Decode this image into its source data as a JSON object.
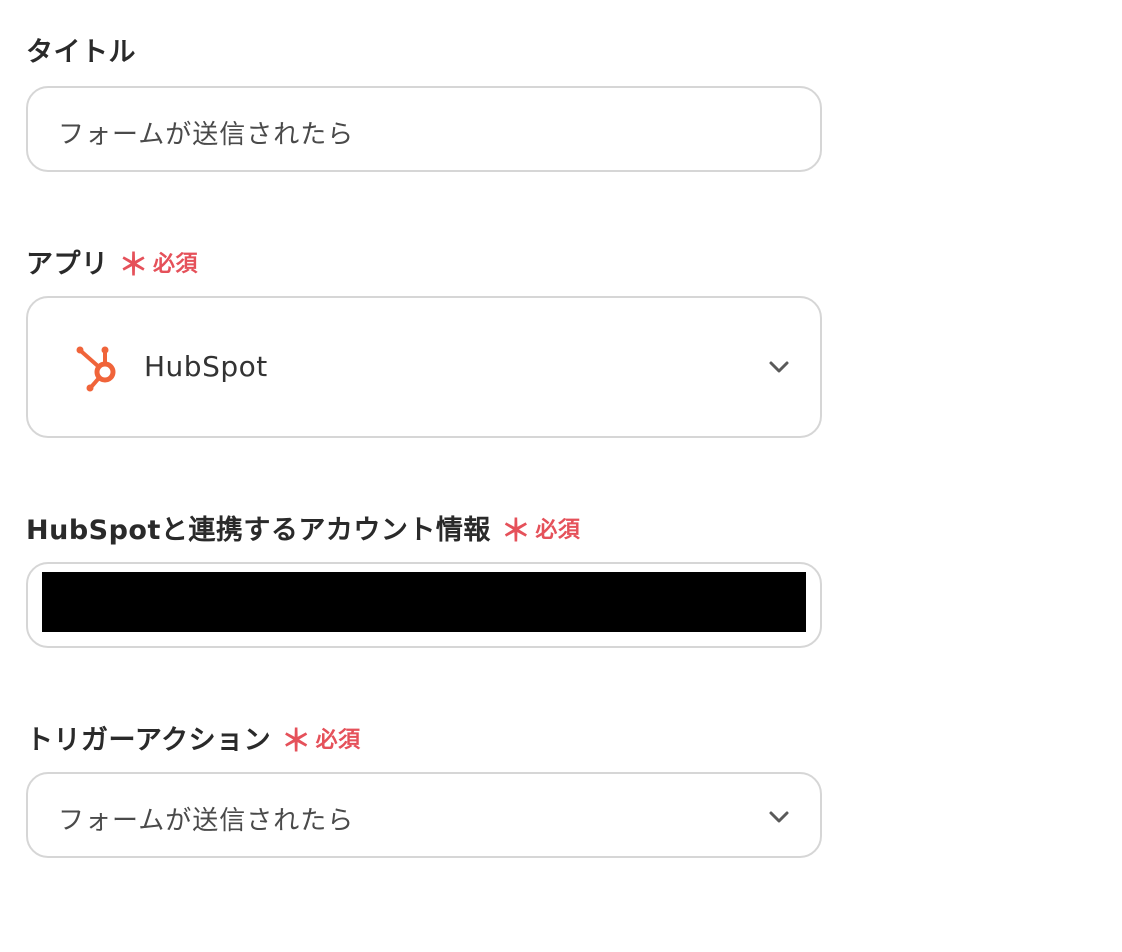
{
  "title_field": {
    "label": "タイトル",
    "value": "フォームが送信されたら"
  },
  "app_field": {
    "label": "アプリ",
    "required_mark": "＊",
    "required_text": "必須",
    "selected_app": "HubSpot",
    "app_icon": "hubspot-logo-icon",
    "app_icon_color": "#f0643a"
  },
  "account_field": {
    "label": "HubSpotと連携するアカウント情報",
    "required_mark": "＊",
    "required_text": "必須"
  },
  "trigger_field": {
    "label": "トリガーアクション",
    "required_mark": "＊",
    "required_text": "必須",
    "selected_value": "フォームが送信されたら"
  },
  "colors": {
    "required": "#e5515a",
    "border": "#d6d6d6",
    "label": "#2a2a2a"
  }
}
